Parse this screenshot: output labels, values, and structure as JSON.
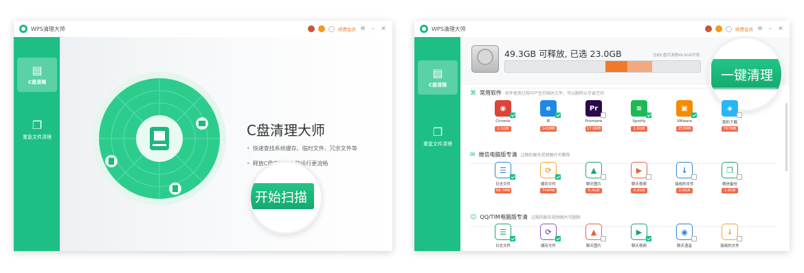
{
  "window1": {
    "title": "WPS清理大师",
    "renew": "续费会员",
    "sidebar": [
      {
        "label": "C盘清理",
        "icon": "drive-icon"
      },
      {
        "label": "重复文件清理",
        "icon": "files-icon"
      }
    ],
    "heading": "C盘清理大师",
    "bullets": [
      "快速查找系统缓存、临时文件、冗余文件等",
      "释放C盘空间，电脑运行更流畅"
    ],
    "scan_label": "开始扫描"
  },
  "window2": {
    "title": "WPS清理大师",
    "renew": "续费会员",
    "sidebar": [
      {
        "label": "C盘清理",
        "icon": "drive-icon"
      },
      {
        "label": "重复文件清理",
        "icon": "files-icon"
      }
    ],
    "summary": "49.3GB 可释放, 已选 23.0GB",
    "note": "当前C盘可清理49.6GB可用",
    "clean_label": "一键清理",
    "sections": [
      {
        "title": "常用软件",
        "desc": "软件使用过程中产生的临时文件，可以删除以节省空间",
        "icon": "apps-icon",
        "apps": [
          {
            "name": "Chrome",
            "size": "2.1GB",
            "checked": true,
            "glyph": "◉",
            "color": "#db4437",
            "outline": false
          },
          {
            "name": "IE",
            "size": "141MB",
            "checked": true,
            "glyph": "e",
            "color": "#1e88e5",
            "outline": false
          },
          {
            "name": "Premiere",
            "size": "17.0MB",
            "checked": false,
            "glyph": "Pr",
            "color": "#2a0a4a",
            "outline": false
          },
          {
            "name": "Spotify",
            "size": "1.6GB",
            "checked": true,
            "glyph": "≋",
            "color": "#1db954",
            "outline": false
          },
          {
            "name": "VMware",
            "size": "253MB",
            "checked": true,
            "glyph": "▣",
            "color": "#f38b00",
            "outline": false
          },
          {
            "name": "我的下载",
            "size": "767MB",
            "checked": false,
            "glyph": "◈",
            "color": "#29b6f6",
            "outline": false
          }
        ]
      },
      {
        "title": "微信电脑版专清",
        "desc": "过期的聊天视频图片可删除",
        "icon": "wechat-icon",
        "apps": [
          {
            "name": "日志文件",
            "size": "68.7MB",
            "checked": true,
            "glyph": "☰",
            "color": "#2f7fd8",
            "outline": true
          },
          {
            "name": "缓存文件",
            "size": "744MB",
            "checked": true,
            "glyph": "⟳",
            "color": "#f2a232",
            "outline": true
          },
          {
            "name": "聊天图片",
            "size": "5.4GB",
            "checked": false,
            "glyph": "▲",
            "color": "#1aa36b",
            "outline": true
          },
          {
            "name": "聊天视频",
            "size": "4.8GB",
            "checked": false,
            "glyph": "▶",
            "color": "#ef5b3a",
            "outline": true
          },
          {
            "name": "接收的文件",
            "size": "2.8GB",
            "checked": false,
            "glyph": "↓",
            "color": "#2f7fd8",
            "outline": true
          },
          {
            "name": "微信备份",
            "size": "1.8GB",
            "checked": false,
            "glyph": "❐",
            "color": "#1aa36b",
            "outline": true
          }
        ]
      },
      {
        "title": "QQ/TIM电脑版专清",
        "desc": "过期的聊天视频图片可删除",
        "icon": "qq-icon",
        "apps": [
          {
            "name": "日志文件",
            "size": "",
            "checked": true,
            "glyph": "☰",
            "color": "#1aa36b",
            "outline": true
          },
          {
            "name": "缓存文件",
            "size": "",
            "checked": true,
            "glyph": "⟳",
            "color": "#7e57c2",
            "outline": true
          },
          {
            "name": "聊天图片",
            "size": "",
            "checked": false,
            "glyph": "▲",
            "color": "#ef5b3a",
            "outline": true
          },
          {
            "name": "聊天视频",
            "size": "",
            "checked": true,
            "glyph": "▶",
            "color": "#1aa36b",
            "outline": true
          },
          {
            "name": "聊天语音",
            "size": "",
            "checked": false,
            "glyph": "◉",
            "color": "#2f7fd8",
            "outline": true
          },
          {
            "name": "接收的文件",
            "size": "",
            "checked": false,
            "glyph": "↓",
            "color": "#f2a232",
            "outline": true
          }
        ]
      }
    ]
  },
  "colors": {
    "brand": "#1dbf84",
    "size_badge": "#f06a4a",
    "bar_segments": [
      "#e5e7e9",
      "#f07a2a",
      "#f3a97f",
      "#e5e7e9"
    ]
  }
}
